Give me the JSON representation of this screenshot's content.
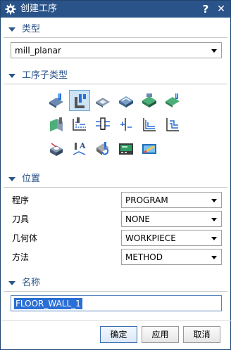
{
  "window": {
    "title": "创建工序",
    "help": "?",
    "close": "✕"
  },
  "sections": {
    "type": {
      "label": "类型",
      "value": "mill_planar"
    },
    "subtype": {
      "label": "工序子类型",
      "icons": [
        "floor-face-mill-icon",
        "planar-mill-icon",
        "floor-wall-mill-icon",
        "floor-wall-is-icon",
        "face-mill-icon",
        "face-mill-manual-icon",
        "cavity-mill-wall-icon",
        "planar-profile-icon",
        "cleanup-corners-icon",
        "finish-walls-icon",
        "finish-floor-icon",
        "slot-mill-icon",
        "hole-mill-icon",
        "planar-text-icon",
        "mill-control-icon",
        "mill-user-icon",
        "mill-tool-icon"
      ],
      "selected_index": 1
    },
    "location": {
      "label": "位置",
      "rows": [
        {
          "label": "程序",
          "value": "PROGRAM"
        },
        {
          "label": "刀具",
          "value": "NONE"
        },
        {
          "label": "几何体",
          "value": "WORKPIECE"
        },
        {
          "label": "方法",
          "value": "METHOD"
        }
      ]
    },
    "name": {
      "label": "名称",
      "value": "FLOOR_WALL_1"
    }
  },
  "buttons": {
    "ok": "确定",
    "apply": "应用",
    "cancel": "取消"
  },
  "colors": {
    "titlebar": "#2a5389",
    "accent": "#2a5389",
    "selection": "#2a6fd6"
  }
}
